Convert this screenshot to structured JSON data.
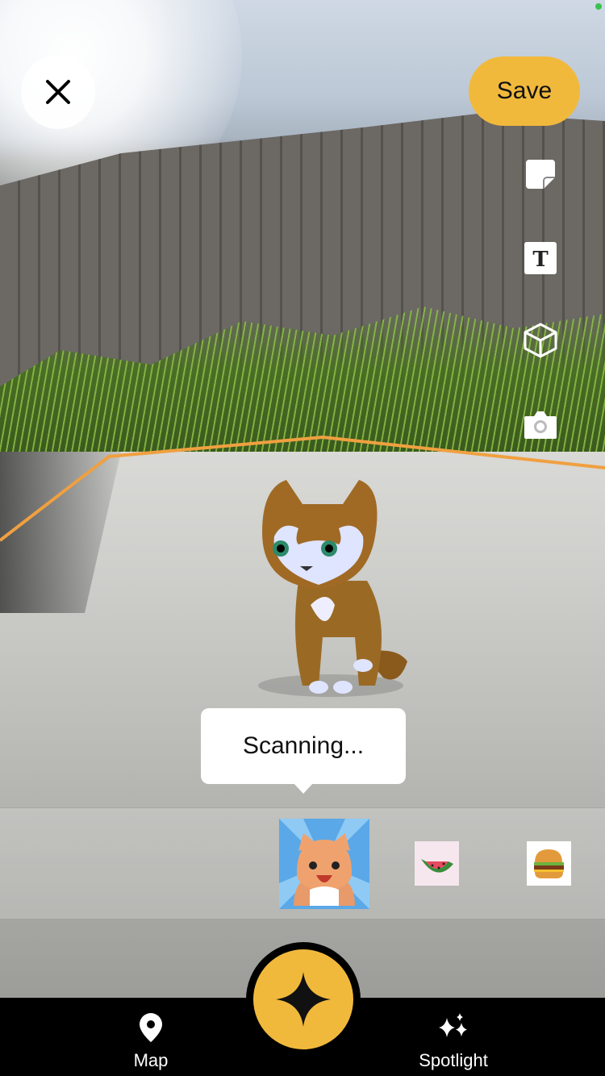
{
  "header": {
    "close_icon": "close-icon",
    "save_label": "Save"
  },
  "toolbar": {
    "tools": [
      "sticker-icon",
      "text-icon",
      "cube-3d-icon",
      "camera-icon"
    ],
    "text_tool_glyph": "T"
  },
  "scanning": {
    "label": "Scanning..."
  },
  "tray": {
    "items": [
      "cat-sticker",
      "watermelon-sticker",
      "burger-sticker"
    ]
  },
  "nav": {
    "map_label": "Map",
    "spotlight_label": "Spotlight",
    "capture_icon": "sparkle-icon"
  },
  "colors": {
    "accent": "#f1b93c",
    "plane_outline": "#f0a040"
  }
}
